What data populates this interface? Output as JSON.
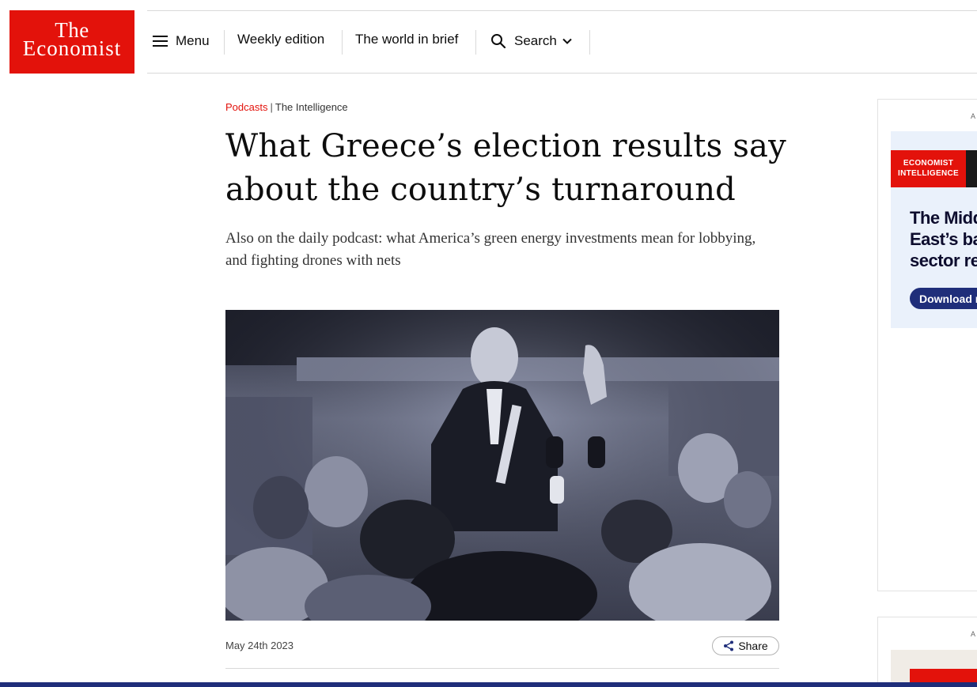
{
  "logo": {
    "line1": "The",
    "line2": "Economist"
  },
  "nav": {
    "menu_label": "Menu",
    "weekly_edition_label": "Weekly edition",
    "world_in_brief_label": "The world in brief",
    "search_label": "Search"
  },
  "article": {
    "section": "Podcasts",
    "separator": "|",
    "series": "The Intelligence",
    "headline": "What Greece’s election results say about the country’s turnaround",
    "subheadline": "Also on the daily podcast: what America’s green energy investments mean for lobbying, and fighting drones with nets",
    "date": "May 24th 2023",
    "share_label": "Share"
  },
  "ad": {
    "label": "A",
    "brand_line1": "ECONOMIST",
    "brand_line2": "INTELLIGENCE",
    "title_line1": "The Midd",
    "title_line2": "East’s ba",
    "title_line3": "sector re",
    "button_label": "Download r"
  },
  "ad2": {
    "label": "A"
  },
  "colors": {
    "brand_red": "#e3120b",
    "navy": "#1f2e7a",
    "ad_bg": "#eaf1fb"
  }
}
